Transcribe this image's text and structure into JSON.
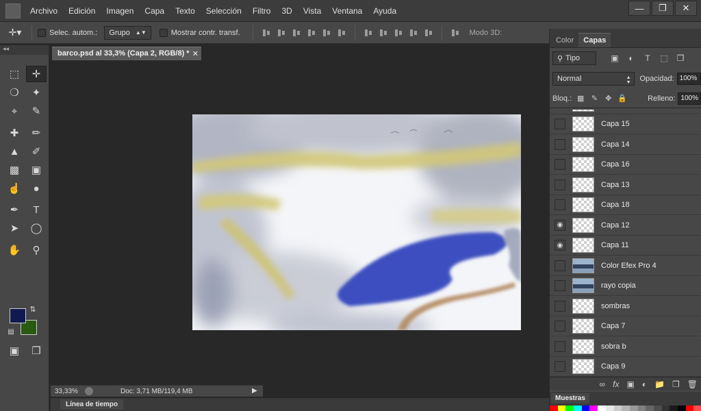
{
  "menubar": {
    "items": [
      "Archivo",
      "Edición",
      "Imagen",
      "Capa",
      "Texto",
      "Selección",
      "Filtro",
      "3D",
      "Vista",
      "Ventana",
      "Ayuda"
    ],
    "window_controls": [
      "minimize-icon",
      "restore-icon",
      "close-icon"
    ]
  },
  "options": {
    "auto_select_label": "Selec. autom.:",
    "auto_select_value": "Grupo",
    "transform_controls_label": "Mostrar contr. transf.",
    "mode3d_label": "Modo 3D:"
  },
  "document": {
    "tab_title": "barco.psd al 33,3% (Capa 2, RGB/8) *",
    "zoom": "33,33%",
    "doc_size": "Doc: 3,71 MB/119,4 MB"
  },
  "colors": {
    "foreground": "#101a50",
    "background": "#2a5a10",
    "accent_blue": "#3c50c0",
    "yellow_stroke": "#d2c878",
    "tan_stroke": "#b48c64"
  },
  "timeline": {
    "label": "Línea de tiempo"
  },
  "panels": {
    "tabs": [
      "Color",
      "Capas"
    ],
    "active_tab": "Capas",
    "filter_label": "Tipo",
    "blend_mode": "Normal",
    "opacity_label": "Opacidad:",
    "opacity_value": "100%",
    "lock_label": "Bloq.:",
    "fill_label": "Relleno:",
    "fill_value": "100%",
    "layers": [
      {
        "name": "Capa 15",
        "visible": false,
        "thumb": "transparent"
      },
      {
        "name": "Capa 14",
        "visible": false,
        "thumb": "transparent"
      },
      {
        "name": "Capa 16",
        "visible": false,
        "thumb": "transparent"
      },
      {
        "name": "Capa 13",
        "visible": false,
        "thumb": "transparent"
      },
      {
        "name": "Capa 18",
        "visible": false,
        "thumb": "transparent"
      },
      {
        "name": "Capa 12",
        "visible": true,
        "thumb": "transparent"
      },
      {
        "name": "Capa 11",
        "visible": true,
        "thumb": "transparent"
      },
      {
        "name": "Color Efex Pro 4",
        "visible": false,
        "thumb": "photo"
      },
      {
        "name": "rayo copia",
        "visible": false,
        "thumb": "photo"
      },
      {
        "name": "sombras",
        "visible": false,
        "thumb": "transparent"
      },
      {
        "name": "Capa 7",
        "visible": false,
        "thumb": "transparent"
      },
      {
        "name": "sobra b",
        "visible": false,
        "thumb": "transparent"
      },
      {
        "name": "Capa 9",
        "visible": false,
        "thumb": "transparent"
      }
    ],
    "swatches_label": "Muestras",
    "swatch_colors": [
      "#ff0000",
      "#ffff00",
      "#00ff00",
      "#00ffff",
      "#0000ff",
      "#ff00ff",
      "#ffffff",
      "#e6e6e6",
      "#cccccc",
      "#b3b3b3",
      "#999999",
      "#808080",
      "#666666",
      "#4d4d4d",
      "#333333",
      "#1a1a1a",
      "#000000",
      "#ff0000",
      "#ff4d4d"
    ]
  }
}
